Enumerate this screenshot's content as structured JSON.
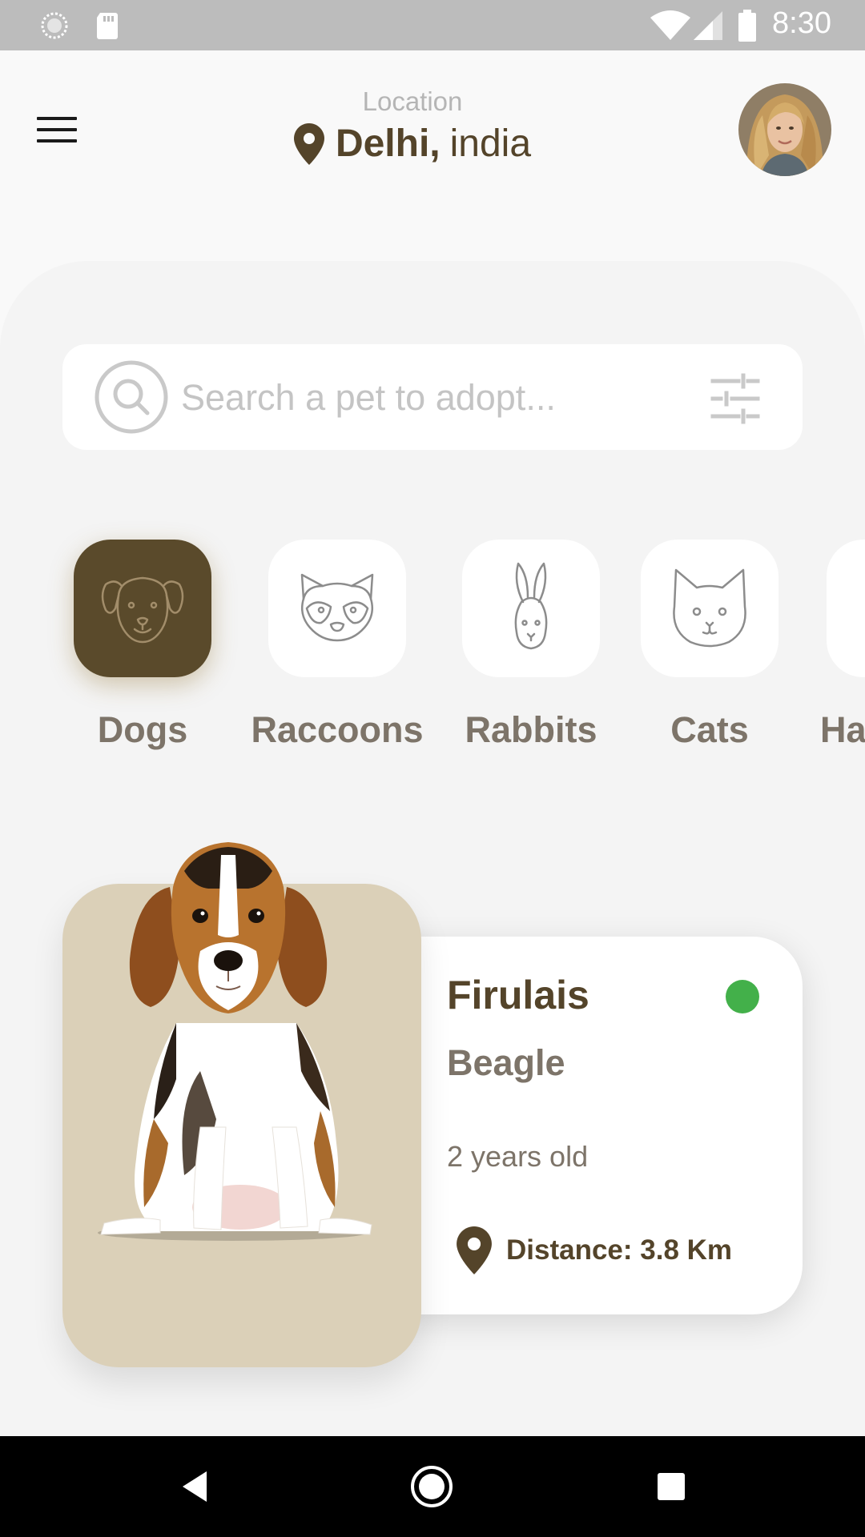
{
  "status_bar": {
    "time": "8:30",
    "left_icons": [
      "sync-icon",
      "sd-card-icon"
    ],
    "right_icons": [
      "wifi-icon",
      "signal-icon",
      "battery-icon"
    ]
  },
  "header": {
    "location_label": "Location",
    "city": "Delhi,",
    "country": "india",
    "menu_icon": "hamburger-menu-icon",
    "location_icon": "map-pin-icon",
    "avatar": "user-avatar"
  },
  "search": {
    "placeholder": "Search a pet to adopt...",
    "value": "",
    "search_icon": "search-icon",
    "filter_icon": "filter-sliders-icon"
  },
  "categories": [
    {
      "label": "Dogs",
      "icon": "dog-icon",
      "active": true
    },
    {
      "label": "Raccoons",
      "icon": "raccoon-icon",
      "active": false
    },
    {
      "label": "Rabbits",
      "icon": "rabbit-icon",
      "active": false
    },
    {
      "label": "Cats",
      "icon": "cat-icon",
      "active": false
    },
    {
      "label": "Ha",
      "icon": "hamster-icon",
      "active": false
    }
  ],
  "pet_card": {
    "name": "Firulais",
    "breed": "Beagle",
    "age": "2 years old",
    "distance": "Distance: 3.8 Km",
    "status_color": "#43b04a",
    "photo": "beagle-puppy-photo"
  },
  "colors": {
    "brand": "#54442a",
    "active_category": "#5a4a2b",
    "muted_text": "#7d7469",
    "card_image_bg": "#dbd0b8"
  },
  "nav_bar": {
    "buttons": [
      "back-icon",
      "home-icon",
      "recents-icon"
    ]
  }
}
